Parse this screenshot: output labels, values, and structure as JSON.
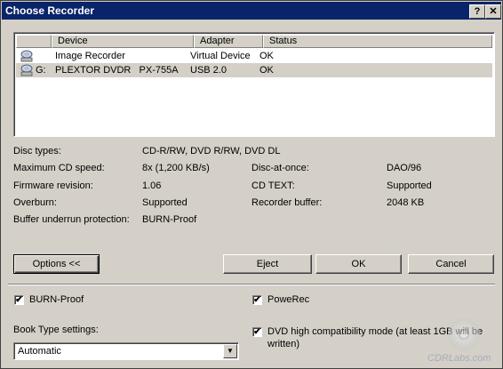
{
  "window": {
    "title": "Choose Recorder",
    "help_glyph": "?",
    "close_glyph": "✕"
  },
  "listview": {
    "columns": [
      "Device",
      "Adapter",
      "Status"
    ],
    "rows": [
      {
        "drive_letter": "",
        "device": "Image Recorder",
        "adapter": "Virtual Device",
        "status": "OK",
        "icon": "image-recorder-icon"
      },
      {
        "drive_letter": "G:",
        "device": "PLEXTOR DVDR   PX-755A",
        "adapter": "USB 2.0",
        "status": "OK",
        "icon": "dvd-drive-icon"
      }
    ]
  },
  "info": {
    "disc_types_label": "Disc types:",
    "disc_types_value": "CD-R/RW, DVD R/RW, DVD DL",
    "max_cd_speed_label": "Maximum CD speed:",
    "max_cd_speed_value": "8x (1,200 KB/s)",
    "firmware_label": "Firmware revision:",
    "firmware_value": "1.06",
    "overburn_label": "Overburn:",
    "overburn_value": "Supported",
    "buffer_protection_label": "Buffer underrun protection:",
    "buffer_protection_value": "BURN-Proof",
    "dao_label": "Disc-at-once:",
    "dao_value": "DAO/96",
    "cdtext_label": "CD TEXT:",
    "cdtext_value": "Supported",
    "recorder_buffer_label": "Recorder buffer:",
    "recorder_buffer_value": "2048 KB"
  },
  "buttons": {
    "options": "Options <<",
    "eject": "Eject",
    "ok": "OK",
    "cancel": "Cancel"
  },
  "options": {
    "burnproof_label": "BURN-Proof",
    "burnproof_checked": true,
    "powerec_label": "PoweRec",
    "powerec_checked": true,
    "booktype_label": "Book Type settings:",
    "booktype_value": "Automatic",
    "dvd_compat_label_line1": "DVD high compatibility mode (at least 1GB will be",
    "dvd_compat_label_line2": "written)",
    "dvd_compat_checked": true,
    "check_glyph": "✔"
  },
  "watermark": "CDRLabs.com",
  "colors": {
    "titlebar": "#0a246a",
    "face": "#d4d0c8"
  }
}
